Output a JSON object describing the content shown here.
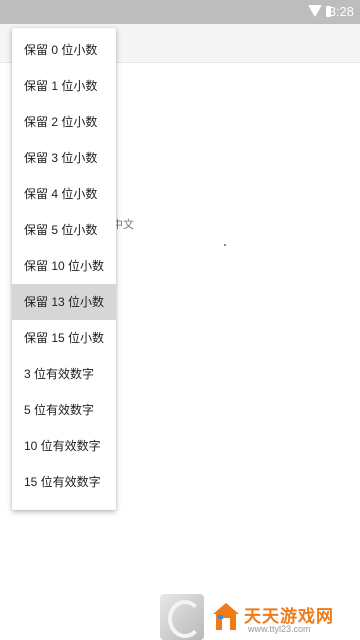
{
  "status_bar": {
    "time": "3:28",
    "icons": [
      "wifi-icon",
      "battery-icon"
    ]
  },
  "background": {
    "partial_text": "中文"
  },
  "menu": {
    "items": [
      {
        "label": "保留 0 位小数",
        "selected": false
      },
      {
        "label": "保留 1 位小数",
        "selected": false
      },
      {
        "label": "保留 2 位小数",
        "selected": false
      },
      {
        "label": "保留 3 位小数",
        "selected": false
      },
      {
        "label": "保留 4 位小数",
        "selected": false
      },
      {
        "label": "保留 5 位小数",
        "selected": false
      },
      {
        "label": "保留 10 位小数",
        "selected": false
      },
      {
        "label": "保留 13 位小数",
        "selected": true
      },
      {
        "label": "保留 15 位小数",
        "selected": false
      },
      {
        "label": "3 位有效数字",
        "selected": false
      },
      {
        "label": "5 位有效数字",
        "selected": false
      },
      {
        "label": "10 位有效数字",
        "selected": false
      },
      {
        "label": "15 位有效数字",
        "selected": false
      }
    ]
  },
  "watermark": {
    "brand": "天天游戏网",
    "site": "www.ttyl23.com",
    "accent_color": "#f07a18"
  }
}
